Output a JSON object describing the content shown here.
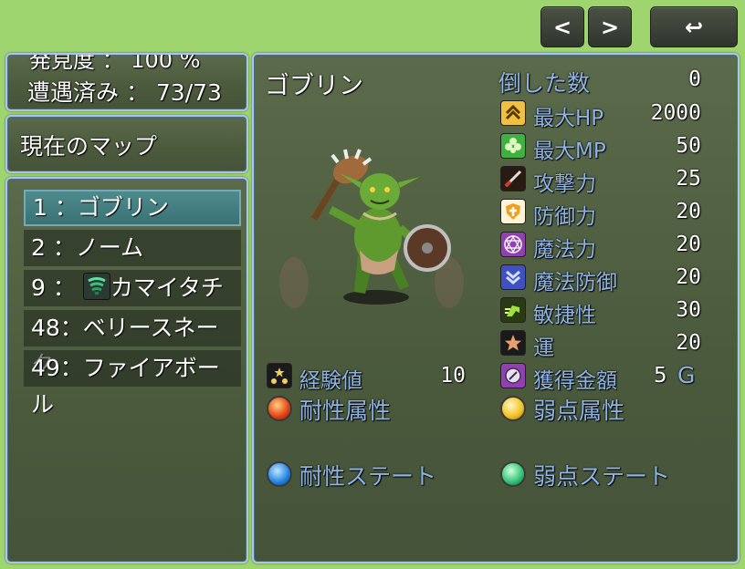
{
  "nav": {
    "prev": "<",
    "next": ">",
    "back": "↩"
  },
  "summary": {
    "discovery_partial": "発見度 ： 100 %",
    "encountered": "遭遇済み ： 73/73"
  },
  "map_filter": {
    "label": "現在のマップ"
  },
  "enemy_list": [
    {
      "label": "1 ：ゴブリン"
    },
    {
      "label": "2 ：ノーム"
    },
    {
      "label": "9 ：",
      "label2": "カマイタチ",
      "has_icon": true
    },
    {
      "label": "48：ベリースネーク"
    },
    {
      "label": "49：ファイアボール"
    }
  ],
  "detail": {
    "name": "ゴブリン",
    "defeated_label": "倒した数",
    "defeated_value": "0",
    "stats": [
      {
        "label": "最大HP",
        "value": "2000",
        "icon": "max-hp-icon",
        "color": "#f0c040"
      },
      {
        "label": "最大MP",
        "value": "50",
        "icon": "max-mp-icon",
        "color": "#40b040"
      },
      {
        "label": "攻撃力",
        "value": "25",
        "icon": "attack-icon",
        "color": "#c04020"
      },
      {
        "label": "防御力",
        "value": "20",
        "icon": "defense-icon",
        "color": "#f0a020"
      },
      {
        "label": "魔法力",
        "value": "20",
        "icon": "magic-icon",
        "color": "#9040b0"
      },
      {
        "label": "魔法防御",
        "value": "20",
        "icon": "magic-defense-icon",
        "color": "#4050c0"
      },
      {
        "label": "敏捷性",
        "value": "30",
        "icon": "agility-icon",
        "color": "#80c030"
      },
      {
        "label": "運",
        "value": "20",
        "icon": "luck-icon",
        "color": "#c07040"
      }
    ],
    "exp_label": "経験値",
    "exp_value": "10",
    "gold_label": "獲得金額",
    "gold_value": "5",
    "gold_unit": "G",
    "resist_element": "耐性属性",
    "weak_element": "弱点属性",
    "resist_state": "耐性ステート",
    "weak_state": "弱点ステート"
  }
}
